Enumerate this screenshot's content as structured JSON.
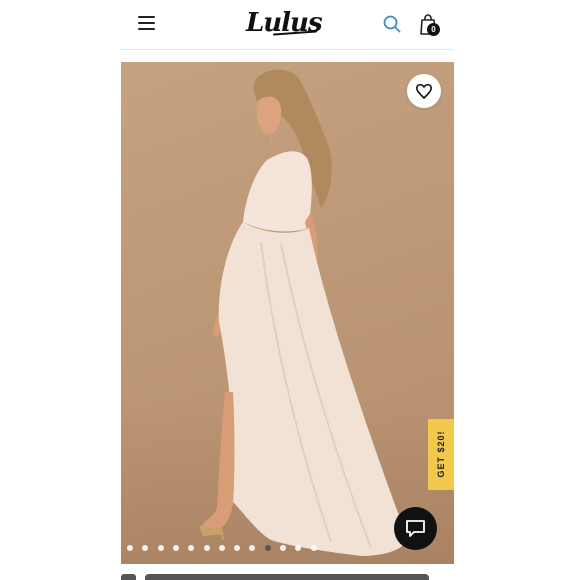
{
  "header": {
    "logo_text": "Lulus",
    "menu_icon": "hamburger-menu-icon",
    "search_icon": "search-icon",
    "bag_icon": "shopping-bag-icon",
    "bag_count": "0",
    "accent_color": "#3b8fd1"
  },
  "product_image": {
    "favorite_icon": "heart-icon",
    "promo_label": "GET $20!",
    "promo_color": "#f2c94c",
    "chat_icon": "chat-icon",
    "slide_count": 13,
    "active_slide": 9
  }
}
